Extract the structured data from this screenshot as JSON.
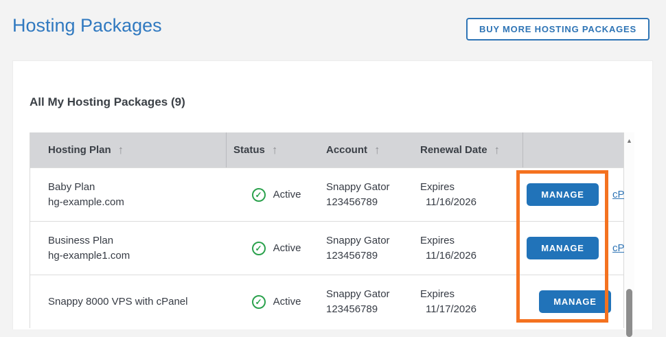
{
  "page": {
    "title": "Hosting Packages",
    "buy_button_label": "BUY MORE HOSTING PACKAGES"
  },
  "card": {
    "heading": "All My Hosting Packages (9)"
  },
  "icons": {
    "sort_asc": "↑",
    "check": "✓",
    "scroll_up": "▲"
  },
  "table": {
    "columns": [
      {
        "label": "Hosting Plan"
      },
      {
        "label": "Status"
      },
      {
        "label": "Account"
      },
      {
        "label": "Renewal Date"
      },
      {
        "label": ""
      }
    ],
    "rows": [
      {
        "plan_name": "Baby Plan",
        "plan_domain": "hg-example.com",
        "status": "Active",
        "account_name": "Snappy Gator",
        "account_id": "123456789",
        "renewal_label": "Expires",
        "renewal_date": "11/16/2026",
        "manage_label": "MANAGE",
        "cpanel_link_label": "cP"
      },
      {
        "plan_name": "Business Plan",
        "plan_domain": "hg-example1.com",
        "status": "Active",
        "account_name": "Snappy Gator",
        "account_id": "123456789",
        "renewal_label": "Expires",
        "renewal_date": "11/16/2026",
        "manage_label": "MANAGE",
        "cpanel_link_label": "cP"
      },
      {
        "plan_name": "Snappy 8000 VPS with cPanel",
        "plan_domain": "",
        "status": "Active",
        "account_name": "Snappy Gator",
        "account_id": "123456789",
        "renewal_label": "Expires",
        "renewal_date": "11/17/2026",
        "manage_label": "MANAGE",
        "cpanel_link_label": ""
      }
    ]
  },
  "colors": {
    "title_blue": "#3079c0",
    "button_blue": "#2173b9",
    "outline_blue": "#2e74b5",
    "status_green": "#2aa14c",
    "highlight_orange": "#f47220",
    "header_gray": "#d4d5d8",
    "page_bg": "#f3f3f3"
  }
}
